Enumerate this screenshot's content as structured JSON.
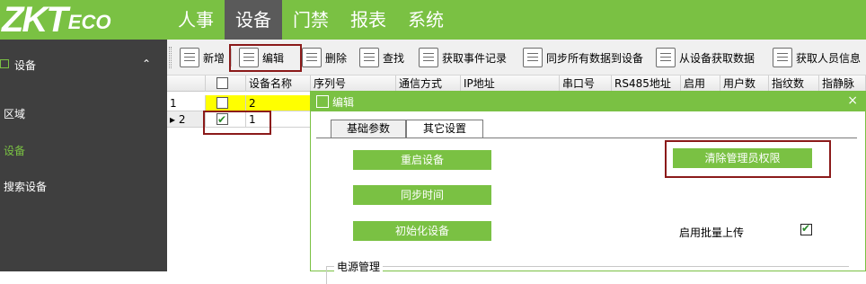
{
  "app": {
    "logo_main": "ZKT",
    "logo_tail": "ECO"
  },
  "menu": {
    "items": [
      "人事",
      "设备",
      "门禁",
      "报表",
      "系统"
    ],
    "active_index": 1
  },
  "sidebar": {
    "header": "设备",
    "header_chevron": "⌃",
    "items": [
      {
        "label": "区域",
        "active": false
      },
      {
        "label": "设备",
        "active": true
      },
      {
        "label": "搜索设备",
        "active": false
      }
    ]
  },
  "toolbar": {
    "buttons": [
      {
        "label": "新增",
        "icon": "add-document-icon"
      },
      {
        "label": "编辑",
        "icon": "edit-icon"
      },
      {
        "label": "删除",
        "icon": "trash-icon"
      },
      {
        "label": "查找",
        "icon": "search-icon"
      },
      {
        "label": "获取事件记录",
        "icon": "fetch-events-icon"
      },
      {
        "label": "同步所有数据到设备",
        "icon": "sync-icon"
      },
      {
        "label": "从设备获取数据",
        "icon": "device-download-icon"
      },
      {
        "label": "获取人员信息",
        "icon": "user-info-icon"
      }
    ]
  },
  "grid": {
    "columns": [
      "",
      "",
      "设备名称",
      "序列号",
      "通信方式",
      "IP地址",
      "串口号",
      "RS485地址",
      "启用",
      "用户数",
      "指纹数",
      "指静脉"
    ],
    "rows": [
      {
        "num": "1",
        "checked": false,
        "name": "2",
        "selected": false
      },
      {
        "num": "2",
        "checked": true,
        "name": "1",
        "selected": true
      }
    ]
  },
  "dialog": {
    "title": "编辑",
    "close": "×",
    "tabs": [
      "基础参数",
      "其它设置"
    ],
    "active_tab": 1,
    "buttons": {
      "restart": "重启设备",
      "sync_time": "同步时间",
      "init": "初始化设备",
      "clear_admin": "清除管理员权限"
    },
    "batch_upload_label": "启用批量上传",
    "batch_upload_checked": true,
    "power_section": "电源管理"
  },
  "colors": {
    "brand_green": "#7ac143",
    "sidebar_bg": "#3f3f3f",
    "highlight_yellow": "#ffff00",
    "annotation_red": "#8b1a1a"
  }
}
